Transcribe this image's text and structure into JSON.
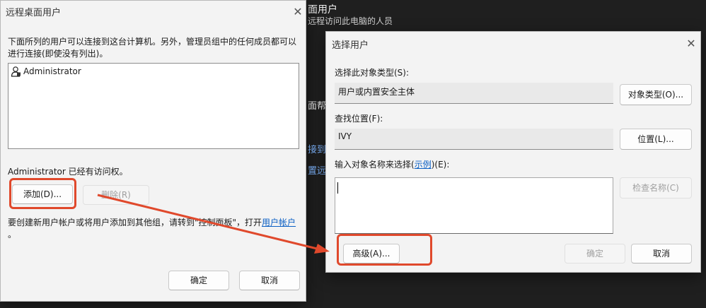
{
  "background": {
    "heading_partial": "面用户",
    "subtitle_partial": "远程访问此电脑的人员",
    "side_text_1": "面帮",
    "side_link_1": "接到",
    "side_link_2": "置远"
  },
  "remote_users_dialog": {
    "title": "远程桌面用户",
    "description_line1": "下面所列的用户可以连接到这台计算机。另外，管理员组中的任何成员都可以",
    "description_line2": "进行连接(即使没有列出)。",
    "users": [
      {
        "name": "Administrator",
        "icon": "user-icon"
      }
    ],
    "access_status": "Administrator 已经有访问权。",
    "add_label": "添加(D)...",
    "remove_label": "删除(R)",
    "footer_text": "要创建新用户帐户或将用户添加到其他组，请转到\"控制面板\"，打开",
    "footer_link": "用户帐户",
    "footer_end": "。",
    "ok_label": "确定",
    "cancel_label": "取消"
  },
  "select_users_dialog": {
    "title": "选择用户",
    "object_type_label": "选择此对象类型(S):",
    "object_type_value": "用户或内置安全主体",
    "object_type_button": "对象类型(O)...",
    "location_label": "查找位置(F):",
    "location_value": "IVY",
    "location_button": "位置(L)...",
    "enter_names_label_prefix": "输入对象名称来选择(",
    "enter_names_link": "示例",
    "enter_names_label_suffix": ")(E):",
    "enter_names_value": "",
    "check_names_label": "检查名称(C)",
    "advanced_label": "高级(A)...",
    "ok_label": "确定",
    "cancel_label": "取消"
  },
  "colors": {
    "highlight": "#e0492c",
    "link": "#0a5fc4",
    "dialog_bg": "#f3f3f3",
    "page_bg": "#1f1f1f"
  }
}
